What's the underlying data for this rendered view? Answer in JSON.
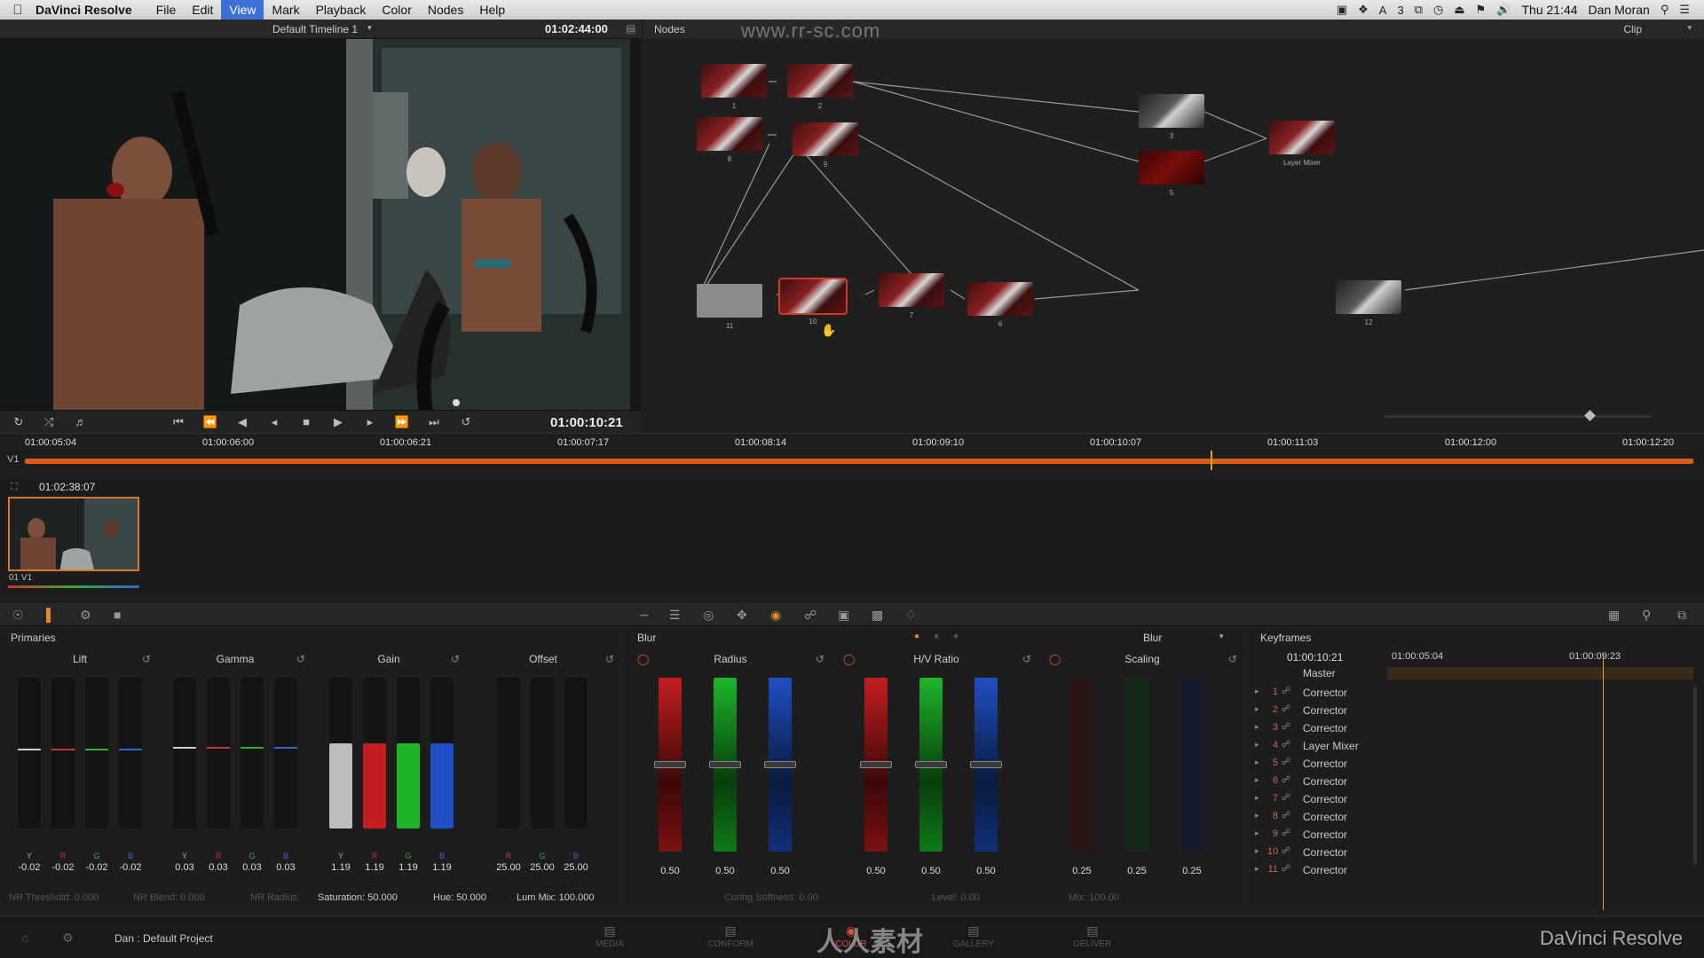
{
  "menubar": {
    "app_name": "DaVinci Resolve",
    "menus": [
      "File",
      "Edit",
      "View",
      "Mark",
      "Playback",
      "Color",
      "Nodes",
      "Help"
    ],
    "active_menu": "View",
    "battery": "3",
    "clock": "Thu 21:44",
    "user": "Dan Moran"
  },
  "watermark": "www.rr-sc.com",
  "viewer": {
    "timeline_name": "Default Timeline 1",
    "header_timecode": "01:02:44:00",
    "transport_timecode": "01:00:10:21"
  },
  "nodes_panel": {
    "title": "Nodes",
    "mode": "Clip",
    "nodes": [
      {
        "label": "1"
      },
      {
        "label": "2"
      },
      {
        "label": "8"
      },
      {
        "label": "9"
      },
      {
        "label": "3"
      },
      {
        "label": "5"
      },
      {
        "label": "Layer Mixer"
      },
      {
        "label": "11"
      },
      {
        "label": "10"
      },
      {
        "label": "7"
      },
      {
        "label": "6"
      },
      {
        "label": "12"
      }
    ]
  },
  "timeline": {
    "ticks": [
      "01:00:05:04",
      "01:00:06:00",
      "01:00:06:21",
      "01:00:07:17",
      "01:00:08:14",
      "01:00:09:10",
      "01:00:10:07",
      "01:00:11:03",
      "01:00:12:00",
      "01:00:12:20"
    ],
    "track": "V1"
  },
  "clip": {
    "timecode": "01:02:38:07",
    "label": "01  V1"
  },
  "primaries": {
    "title": "Primaries",
    "groups": [
      {
        "name": "Lift",
        "values": [
          "-0.02",
          "-0.02",
          "-0.02",
          "-0.02"
        ]
      },
      {
        "name": "Gamma",
        "values": [
          "0.03",
          "0.03",
          "0.03",
          "0.03"
        ]
      },
      {
        "name": "Gain",
        "values": [
          "1.19",
          "1.19",
          "1.19",
          "1.19"
        ]
      },
      {
        "name": "Offset",
        "values": [
          "25.00",
          "25.00",
          "25.00"
        ]
      }
    ],
    "channels": [
      "Y",
      "R",
      "G",
      "B"
    ],
    "footer": {
      "nr_threshold": "NR Threshold:  0.000",
      "nr_blend": "NR Blend:  0.000",
      "nr_radius": "NR Radius:",
      "saturation": "Saturation:  50.000",
      "hue": "Hue:  50.000",
      "lum_mix": "Lum Mix:  100.000"
    }
  },
  "blur": {
    "title": "Blur",
    "mode": "Blur",
    "groups": [
      {
        "name": "Radius",
        "values": [
          "0.50",
          "0.50",
          "0.50"
        ]
      },
      {
        "name": "H/V Ratio",
        "values": [
          "0.50",
          "0.50",
          "0.50"
        ]
      },
      {
        "name": "Scaling",
        "values": [
          "0.25",
          "0.25",
          "0.25"
        ]
      }
    ],
    "footer": {
      "coring": "Coring Softness:  0.00",
      "level": "Level:  0.00",
      "mix": "Mix:  100.00"
    }
  },
  "keyframes": {
    "title": "Keyframes",
    "timecodes": [
      "01:00:10:21",
      "01:00:05:04",
      "01:00:09:23"
    ],
    "master": "Master",
    "rows": [
      {
        "num": "1",
        "name": "Corrector"
      },
      {
        "num": "2",
        "name": "Corrector"
      },
      {
        "num": "3",
        "name": "Corrector"
      },
      {
        "num": "4",
        "name": "Layer Mixer"
      },
      {
        "num": "5",
        "name": "Corrector"
      },
      {
        "num": "6",
        "name": "Corrector"
      },
      {
        "num": "7",
        "name": "Corrector"
      },
      {
        "num": "8",
        "name": "Corrector"
      },
      {
        "num": "9",
        "name": "Corrector"
      },
      {
        "num": "10",
        "name": "Corrector"
      },
      {
        "num": "11",
        "name": "Corrector"
      }
    ]
  },
  "bottom_nav": {
    "project": "Dan : Default Project",
    "tabs": [
      "MEDIA",
      "CONFORM",
      "COLOR",
      "GALLERY",
      "DELIVER"
    ],
    "active_tab": "COLOR",
    "brand": "DaVinci Resolve",
    "watermark_text": "人人素材"
  }
}
